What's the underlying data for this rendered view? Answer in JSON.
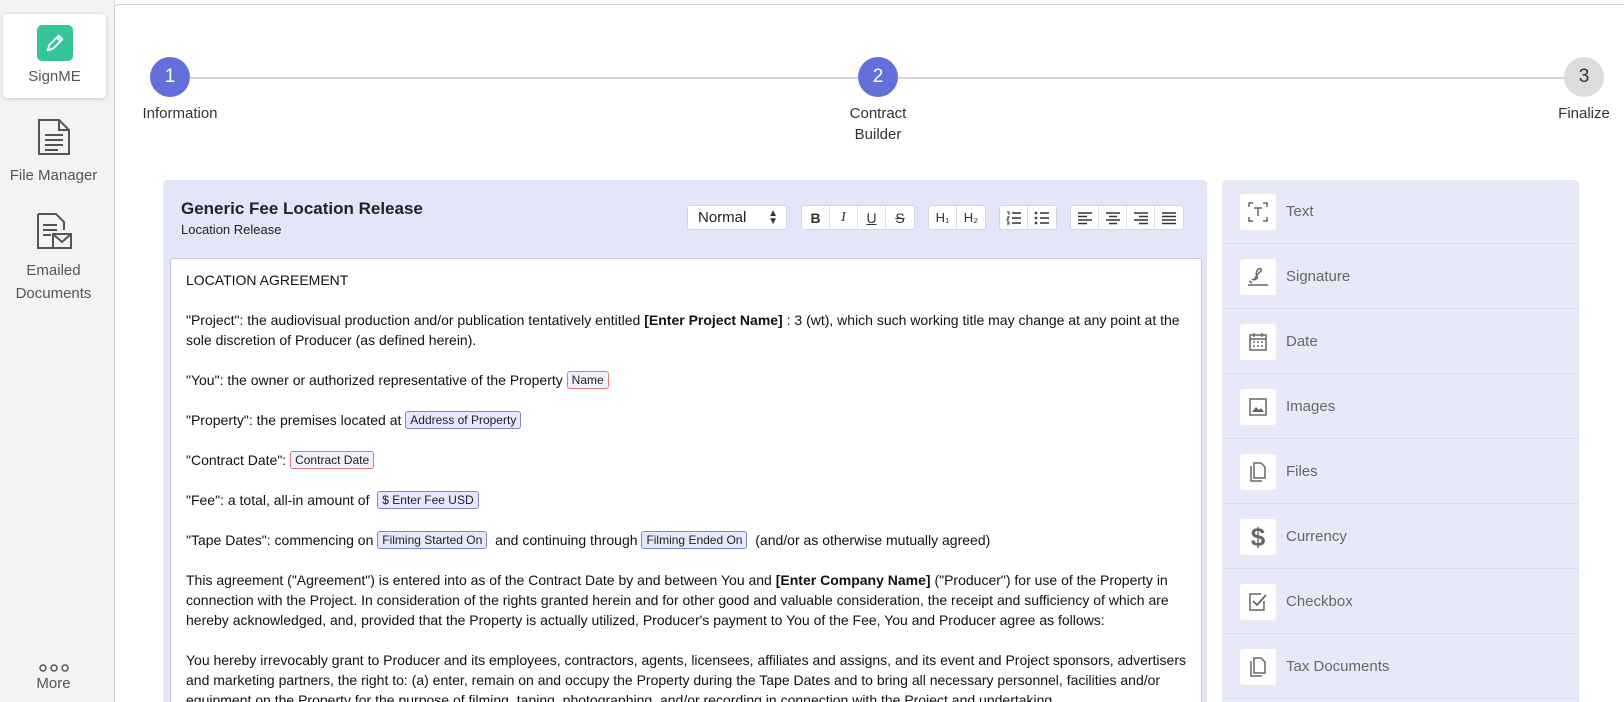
{
  "sidebar": {
    "items": [
      {
        "label": "SignME",
        "icon": "pen-icon"
      },
      {
        "label": "File Manager",
        "icon": "document-icon"
      },
      {
        "label": "Emailed Documents",
        "icon": "email-document-icon"
      }
    ],
    "more": {
      "label": "More",
      "icon": "ellipsis-icon"
    }
  },
  "stepper": {
    "steps": [
      {
        "number": "1",
        "label": "Information",
        "status": "complete"
      },
      {
        "number": "2",
        "label": "Contract Builder",
        "label_line1": "Contract",
        "label_line2": "Builder",
        "status": "current"
      },
      {
        "number": "3",
        "label": "Finalize",
        "status": "pending"
      }
    ]
  },
  "editor": {
    "title": "Generic Fee Location Release",
    "subtitle": "Location Release",
    "format_select": "Normal",
    "toolbar": {
      "bold": "B",
      "italic": "I",
      "underline": "U",
      "strike": "S",
      "h1": "H₁",
      "h2": "H₂"
    },
    "body": {
      "heading": "LOCATION AGREEMENT",
      "project": {
        "pre": "\"Project\":  the audiovisual production and/or publication tentatively entitled ",
        "bold": "[Enter Project Name]",
        "post": " : 3 (wt), which such working title may change at any point at the sole discretion of Producer (as defined herein)."
      },
      "you": {
        "pre": "\"You\":  the owner or authorized representative of the Property ",
        "tag": "Name"
      },
      "property": {
        "pre": "\"Property\":  the premises located at ",
        "tag": "Address of Property"
      },
      "contract_date": {
        "pre": "\"Contract Date\": ",
        "tag": "Contract Date"
      },
      "fee": {
        "pre": "\"Fee\": a total, all-in amount of  ",
        "tag": "$ Enter Fee USD"
      },
      "tape_dates": {
        "pre": "\"Tape Dates\":  commencing on ",
        "tag1": "Filming Started On",
        "mid": "  and continuing through ",
        "tag2": "Filming Ended On",
        "post": "  (and/or as otherwise mutually agreed)"
      },
      "agreement": {
        "pre": "This agreement (\"Agreement\") is entered into as of the Contract Date by and between You and ",
        "bold": "[Enter Company Name]",
        "post": "  (\"Producer\") for use of the Property in connection with the Project.  In consideration of the rights granted herein and for other good and valuable consideration, the receipt and sufficiency of which are hereby acknowledged, and, provided that the Property is actually utilized, Producer's payment to You of the Fee, You and Producer agree as follows:"
      },
      "grant": "You hereby irrevocably grant to Producer and its employees, contractors, agents, licensees, affiliates and assigns, and its event and Project sponsors, advertisers and marketing partners, the right to: (a) enter, remain on and occupy the Property during the Tape Dates and to bring all necessary personnel, facilities and/or equipment on the Property for the purpose of filming, taping, photographing, and/or recording in connection with the Project and undertaking"
    }
  },
  "fields": [
    {
      "label": "Text",
      "icon": "text-field-icon"
    },
    {
      "label": "Signature",
      "icon": "signature-icon"
    },
    {
      "label": "Date",
      "icon": "calendar-icon"
    },
    {
      "label": "Images",
      "icon": "image-icon"
    },
    {
      "label": "Files",
      "icon": "files-icon"
    },
    {
      "label": "Currency",
      "icon": "dollar-icon"
    },
    {
      "label": "Checkbox",
      "icon": "checkbox-icon"
    },
    {
      "label": "Tax Documents",
      "icon": "tax-documents-icon"
    }
  ],
  "colors": {
    "accent": "#6470d9",
    "brand_green": "#34c59a",
    "editor_header_bg": "#e3e5f8",
    "fields_panel_bg": "#e8e9f8"
  }
}
